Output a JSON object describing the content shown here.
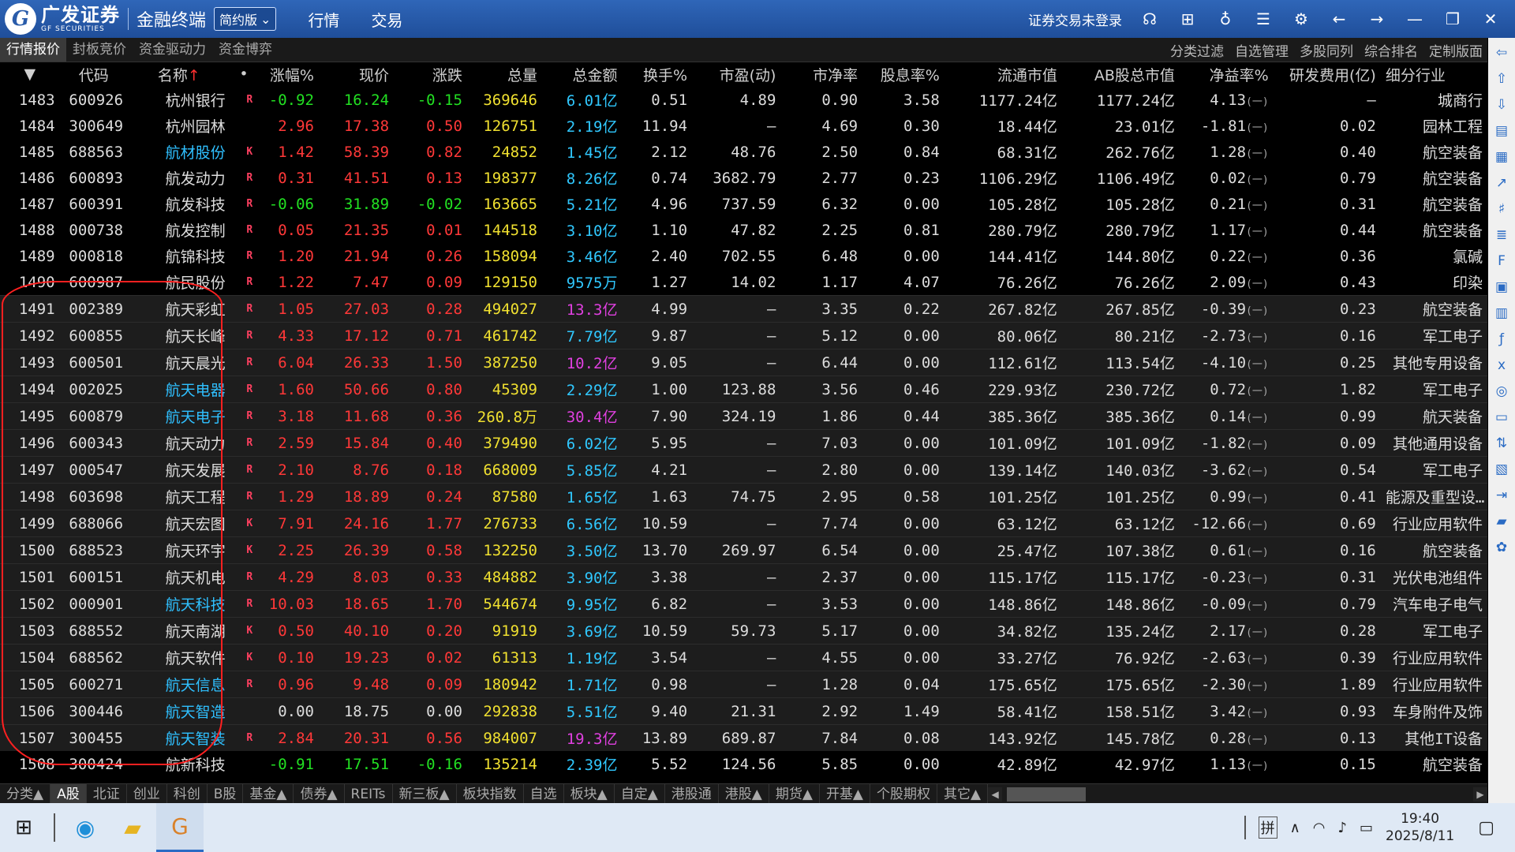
{
  "titlebar": {
    "logo_cn": "广发证券",
    "logo_en": "GF SECURITIES",
    "app_name": "金融终端",
    "edition": "简约版",
    "menu": [
      "行情",
      "交易"
    ],
    "login_status": "证券交易未登录",
    "icons": [
      "headset-icon",
      "grid-icon",
      "shirt-icon",
      "list-icon",
      "settings-icon",
      "back-arrow-icon",
      "forward-arrow-icon",
      "minimize-icon",
      "restore-icon",
      "close-icon"
    ]
  },
  "tabs": [
    "行情报价",
    "封板竞价",
    "资金驱动力",
    "资金博弈"
  ],
  "tab_actions": [
    "分类过滤",
    "自选管理",
    "多股同列",
    "综合排名",
    "定制版面"
  ],
  "columns": [
    "",
    "代码",
    "名称",
    "",
    "涨幅%",
    "现价",
    "涨跌",
    "总量",
    "总金额",
    "换手%",
    "市盈(动)",
    "市净率",
    "股息率%",
    "流通市值",
    "AB股总市值",
    "净益率%",
    "研发费用(亿)",
    "细分行业"
  ],
  "rows": [
    {
      "idx": "1483",
      "code": "600926",
      "name": "杭州银行",
      "link": false,
      "flag": "R",
      "pct": "-0.92",
      "price": "16.24",
      "chg": "-0.15",
      "vol": "369646",
      "amt": "6.01亿",
      "amt_hot": false,
      "turn": "0.51",
      "pe": "4.89",
      "pb": "0.90",
      "div": "3.58",
      "float_cap": "1177.24亿",
      "total_cap": "1177.24亿",
      "roe": "4.13",
      "rd": "—",
      "ind": "城商行",
      "hl": false
    },
    {
      "idx": "1484",
      "code": "300649",
      "name": "杭州园林",
      "link": false,
      "flag": "",
      "pct": "2.96",
      "price": "17.38",
      "chg": "0.50",
      "vol": "126751",
      "amt": "2.19亿",
      "amt_hot": false,
      "turn": "11.94",
      "pe": "—",
      "pb": "4.69",
      "div": "0.30",
      "float_cap": "18.44亿",
      "total_cap": "23.01亿",
      "roe": "-1.81",
      "rd": "0.02",
      "ind": "园林工程",
      "hl": false
    },
    {
      "idx": "1485",
      "code": "688563",
      "name": "航材股份",
      "link": true,
      "flag": "K",
      "pct": "1.42",
      "price": "58.39",
      "chg": "0.82",
      "vol": "24852",
      "amt": "1.45亿",
      "amt_hot": false,
      "turn": "2.12",
      "pe": "48.76",
      "pb": "2.50",
      "div": "0.84",
      "float_cap": "68.31亿",
      "total_cap": "262.76亿",
      "roe": "1.28",
      "rd": "0.40",
      "ind": "航空装备",
      "hl": false
    },
    {
      "idx": "1486",
      "code": "600893",
      "name": "航发动力",
      "link": false,
      "flag": "R",
      "pct": "0.31",
      "price": "41.51",
      "chg": "0.13",
      "vol": "198377",
      "amt": "8.26亿",
      "amt_hot": false,
      "turn": "0.74",
      "pe": "3682.79",
      "pb": "2.77",
      "div": "0.23",
      "float_cap": "1106.29亿",
      "total_cap": "1106.49亿",
      "roe": "0.02",
      "rd": "0.79",
      "ind": "航空装备",
      "hl": false
    },
    {
      "idx": "1487",
      "code": "600391",
      "name": "航发科技",
      "link": false,
      "flag": "R",
      "pct": "-0.06",
      "price": "31.89",
      "chg": "-0.02",
      "vol": "163665",
      "amt": "5.21亿",
      "amt_hot": false,
      "turn": "4.96",
      "pe": "737.59",
      "pb": "6.32",
      "div": "0.00",
      "float_cap": "105.28亿",
      "total_cap": "105.28亿",
      "roe": "0.21",
      "rd": "0.31",
      "ind": "航空装备",
      "hl": false
    },
    {
      "idx": "1488",
      "code": "000738",
      "name": "航发控制",
      "link": false,
      "flag": "R",
      "pct": "0.05",
      "price": "21.35",
      "chg": "0.01",
      "vol": "144518",
      "amt": "3.10亿",
      "amt_hot": false,
      "turn": "1.10",
      "pe": "47.82",
      "pb": "2.25",
      "div": "0.81",
      "float_cap": "280.79亿",
      "total_cap": "280.79亿",
      "roe": "1.17",
      "rd": "0.44",
      "ind": "航空装备",
      "hl": false
    },
    {
      "idx": "1489",
      "code": "000818",
      "name": "航锦科技",
      "link": false,
      "flag": "R",
      "pct": "1.20",
      "price": "21.94",
      "chg": "0.26",
      "vol": "158094",
      "amt": "3.46亿",
      "amt_hot": false,
      "turn": "2.40",
      "pe": "702.55",
      "pb": "6.48",
      "div": "0.00",
      "float_cap": "144.41亿",
      "total_cap": "144.80亿",
      "roe": "0.22",
      "rd": "0.36",
      "ind": "氯碱",
      "hl": false
    },
    {
      "idx": "1490",
      "code": "600987",
      "name": "航民股份",
      "link": false,
      "flag": "R",
      "pct": "1.22",
      "price": "7.47",
      "chg": "0.09",
      "vol": "129150",
      "amt": "9575万",
      "amt_hot": false,
      "turn": "1.27",
      "pe": "14.02",
      "pb": "1.17",
      "div": "4.07",
      "float_cap": "76.26亿",
      "total_cap": "76.26亿",
      "roe": "2.09",
      "rd": "0.43",
      "ind": "印染",
      "hl": false
    },
    {
      "idx": "1491",
      "code": "002389",
      "name": "航天彩虹",
      "link": false,
      "flag": "R",
      "pct": "1.05",
      "price": "27.03",
      "chg": "0.28",
      "vol": "494027",
      "amt": "13.3亿",
      "amt_hot": true,
      "turn": "4.99",
      "pe": "—",
      "pb": "3.35",
      "div": "0.22",
      "float_cap": "267.82亿",
      "total_cap": "267.85亿",
      "roe": "-0.39",
      "rd": "0.23",
      "ind": "航空装备",
      "hl": true
    },
    {
      "idx": "1492",
      "code": "600855",
      "name": "航天长峰",
      "link": false,
      "flag": "R",
      "pct": "4.33",
      "price": "17.12",
      "chg": "0.71",
      "vol": "461742",
      "amt": "7.79亿",
      "amt_hot": false,
      "turn": "9.87",
      "pe": "—",
      "pb": "5.12",
      "div": "0.00",
      "float_cap": "80.06亿",
      "total_cap": "80.21亿",
      "roe": "-2.73",
      "rd": "0.16",
      "ind": "军工电子",
      "hl": true
    },
    {
      "idx": "1493",
      "code": "600501",
      "name": "航天晨光",
      "link": false,
      "flag": "R",
      "pct": "6.04",
      "price": "26.33",
      "chg": "1.50",
      "vol": "387250",
      "amt": "10.2亿",
      "amt_hot": true,
      "turn": "9.05",
      "pe": "—",
      "pb": "6.44",
      "div": "0.00",
      "float_cap": "112.61亿",
      "total_cap": "113.54亿",
      "roe": "-4.10",
      "rd": "0.25",
      "ind": "其他专用设备",
      "hl": true
    },
    {
      "idx": "1494",
      "code": "002025",
      "name": "航天电器",
      "link": true,
      "flag": "R",
      "pct": "1.60",
      "price": "50.66",
      "chg": "0.80",
      "vol": "45309",
      "amt": "2.29亿",
      "amt_hot": false,
      "turn": "1.00",
      "pe": "123.88",
      "pb": "3.56",
      "div": "0.46",
      "float_cap": "229.93亿",
      "total_cap": "230.72亿",
      "roe": "0.72",
      "rd": "1.82",
      "ind": "军工电子",
      "hl": true
    },
    {
      "idx": "1495",
      "code": "600879",
      "name": "航天电子",
      "link": true,
      "flag": "R",
      "pct": "3.18",
      "price": "11.68",
      "chg": "0.36",
      "vol": "260.8万",
      "amt": "30.4亿",
      "amt_hot": true,
      "turn": "7.90",
      "pe": "324.19",
      "pb": "1.86",
      "div": "0.44",
      "float_cap": "385.36亿",
      "total_cap": "385.36亿",
      "roe": "0.14",
      "rd": "0.99",
      "ind": "航天装备",
      "hl": true
    },
    {
      "idx": "1496",
      "code": "600343",
      "name": "航天动力",
      "link": false,
      "flag": "R",
      "pct": "2.59",
      "price": "15.84",
      "chg": "0.40",
      "vol": "379490",
      "amt": "6.02亿",
      "amt_hot": false,
      "turn": "5.95",
      "pe": "—",
      "pb": "7.03",
      "div": "0.00",
      "float_cap": "101.09亿",
      "total_cap": "101.09亿",
      "roe": "-1.82",
      "rd": "0.09",
      "ind": "其他通用设备",
      "hl": true
    },
    {
      "idx": "1497",
      "code": "000547",
      "name": "航天发展",
      "link": false,
      "flag": "R",
      "pct": "2.10",
      "price": "8.76",
      "chg": "0.18",
      "vol": "668009",
      "amt": "5.85亿",
      "amt_hot": false,
      "turn": "4.21",
      "pe": "—",
      "pb": "2.80",
      "div": "0.00",
      "float_cap": "139.14亿",
      "total_cap": "140.03亿",
      "roe": "-3.62",
      "rd": "0.54",
      "ind": "军工电子",
      "hl": true
    },
    {
      "idx": "1498",
      "code": "603698",
      "name": "航天工程",
      "link": false,
      "flag": "R",
      "pct": "1.29",
      "price": "18.89",
      "chg": "0.24",
      "vol": "87580",
      "amt": "1.65亿",
      "amt_hot": false,
      "turn": "1.63",
      "pe": "74.75",
      "pb": "2.95",
      "div": "0.58",
      "float_cap": "101.25亿",
      "total_cap": "101.25亿",
      "roe": "0.99",
      "rd": "0.41",
      "ind": "能源及重型设…",
      "hl": true
    },
    {
      "idx": "1499",
      "code": "688066",
      "name": "航天宏图",
      "link": false,
      "flag": "K",
      "pct": "7.91",
      "price": "24.16",
      "chg": "1.77",
      "vol": "276733",
      "amt": "6.56亿",
      "amt_hot": false,
      "turn": "10.59",
      "pe": "—",
      "pb": "7.74",
      "div": "0.00",
      "float_cap": "63.12亿",
      "total_cap": "63.12亿",
      "roe": "-12.66",
      "rd": "0.69",
      "ind": "行业应用软件",
      "hl": true
    },
    {
      "idx": "1500",
      "code": "688523",
      "name": "航天环宇",
      "link": false,
      "flag": "K",
      "pct": "2.25",
      "price": "26.39",
      "chg": "0.58",
      "vol": "132250",
      "amt": "3.50亿",
      "amt_hot": false,
      "turn": "13.70",
      "pe": "269.97",
      "pb": "6.54",
      "div": "0.00",
      "float_cap": "25.47亿",
      "total_cap": "107.38亿",
      "roe": "0.61",
      "rd": "0.16",
      "ind": "航空装备",
      "hl": true
    },
    {
      "idx": "1501",
      "code": "600151",
      "name": "航天机电",
      "link": false,
      "flag": "R",
      "pct": "4.29",
      "price": "8.03",
      "chg": "0.33",
      "vol": "484882",
      "amt": "3.90亿",
      "amt_hot": false,
      "turn": "3.38",
      "pe": "—",
      "pb": "2.37",
      "div": "0.00",
      "float_cap": "115.17亿",
      "total_cap": "115.17亿",
      "roe": "-0.23",
      "rd": "0.31",
      "ind": "光伏电池组件",
      "hl": true
    },
    {
      "idx": "1502",
      "code": "000901",
      "name": "航天科技",
      "link": true,
      "flag": "R",
      "pct": "10.03",
      "price": "18.65",
      "chg": "1.70",
      "vol": "544674",
      "amt": "9.95亿",
      "amt_hot": false,
      "turn": "6.82",
      "pe": "—",
      "pb": "3.53",
      "div": "0.00",
      "float_cap": "148.86亿",
      "total_cap": "148.86亿",
      "roe": "-0.09",
      "rd": "0.79",
      "ind": "汽车电子电气",
      "hl": true
    },
    {
      "idx": "1503",
      "code": "688552",
      "name": "航天南湖",
      "link": false,
      "flag": "K",
      "pct": "0.50",
      "price": "40.10",
      "chg": "0.20",
      "vol": "91919",
      "amt": "3.69亿",
      "amt_hot": false,
      "turn": "10.59",
      "pe": "59.73",
      "pb": "5.17",
      "div": "0.00",
      "float_cap": "34.82亿",
      "total_cap": "135.24亿",
      "roe": "2.17",
      "rd": "0.28",
      "ind": "军工电子",
      "hl": true
    },
    {
      "idx": "1504",
      "code": "688562",
      "name": "航天软件",
      "link": false,
      "flag": "K",
      "pct": "0.10",
      "price": "19.23",
      "chg": "0.02",
      "vol": "61313",
      "amt": "1.19亿",
      "amt_hot": false,
      "turn": "3.54",
      "pe": "—",
      "pb": "4.55",
      "div": "0.00",
      "float_cap": "33.27亿",
      "total_cap": "76.92亿",
      "roe": "-2.63",
      "rd": "0.39",
      "ind": "行业应用软件",
      "hl": true
    },
    {
      "idx": "1505",
      "code": "600271",
      "name": "航天信息",
      "link": true,
      "flag": "R",
      "pct": "0.96",
      "price": "9.48",
      "chg": "0.09",
      "vol": "180942",
      "amt": "1.71亿",
      "amt_hot": false,
      "turn": "0.98",
      "pe": "—",
      "pb": "1.28",
      "div": "0.04",
      "float_cap": "175.65亿",
      "total_cap": "175.65亿",
      "roe": "-2.30",
      "rd": "1.89",
      "ind": "行业应用软件",
      "hl": true
    },
    {
      "idx": "1506",
      "code": "300446",
      "name": "航天智造",
      "link": true,
      "flag": "",
      "pct": "0.00",
      "price": "18.75",
      "chg": "0.00",
      "vol": "292838",
      "amt": "5.51亿",
      "amt_hot": false,
      "turn": "9.40",
      "pe": "21.31",
      "pb": "2.92",
      "div": "1.49",
      "float_cap": "58.41亿",
      "total_cap": "158.51亿",
      "roe": "3.42",
      "rd": "0.93",
      "ind": "车身附件及饰",
      "hl": true
    },
    {
      "idx": "1507",
      "code": "300455",
      "name": "航天智装",
      "link": true,
      "flag": "R",
      "pct": "2.84",
      "price": "20.31",
      "chg": "0.56",
      "vol": "984007",
      "amt": "19.3亿",
      "amt_hot": true,
      "turn": "13.89",
      "pe": "689.87",
      "pb": "7.84",
      "div": "0.08",
      "float_cap": "143.92亿",
      "total_cap": "145.78亿",
      "roe": "0.28",
      "rd": "0.13",
      "ind": "其他IT设备",
      "hl": true
    },
    {
      "idx": "1508",
      "code": "300424",
      "name": "航新科技",
      "link": false,
      "flag": "",
      "pct": "-0.91",
      "price": "17.51",
      "chg": "-0.16",
      "vol": "135214",
      "amt": "2.39亿",
      "amt_hot": false,
      "turn": "5.52",
      "pe": "124.56",
      "pb": "5.85",
      "div": "0.00",
      "float_cap": "42.89亿",
      "total_cap": "42.97亿",
      "roe": "1.13",
      "rd": "0.15",
      "ind": "航空装备",
      "hl": false
    }
  ],
  "circle_mark": "(一)",
  "bottom_tabs": [
    "分类▲",
    "A股",
    "北证",
    "创业",
    "科创",
    "B股",
    "基金▲",
    "债券▲",
    "REITs",
    "新三板▲",
    "板块指数",
    "自选",
    "板块▲",
    "自定▲",
    "港股通",
    "港股▲",
    "期货▲",
    "开基▲",
    "个股期权",
    "其它▲"
  ],
  "taskbar": {
    "ime": "拼",
    "time": "19:40",
    "date": "2025/8/11"
  },
  "colors": {
    "up": "#ff3838",
    "down": "#22e022",
    "volume": "#f0e030",
    "amount": "#30c8ff",
    "amount_hot": "#e040e0",
    "link": "#2fc0ff",
    "annotation": "#ff2020"
  }
}
